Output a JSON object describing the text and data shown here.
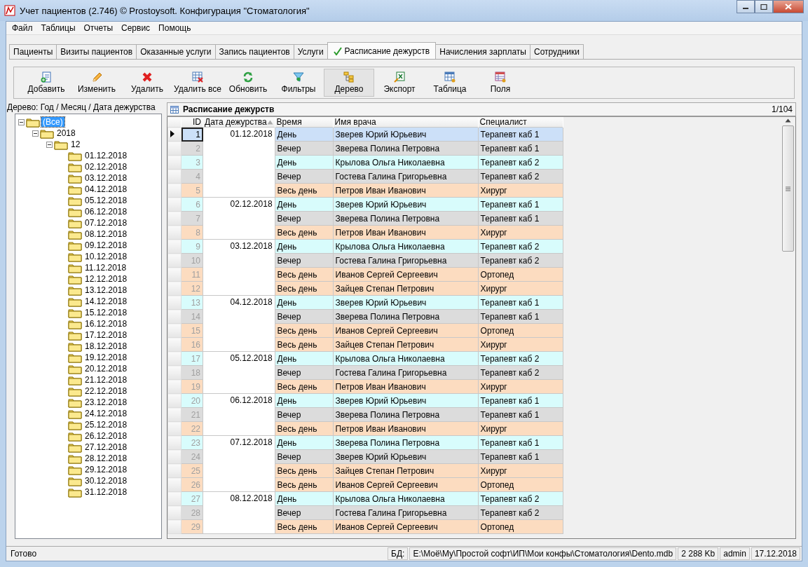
{
  "window": {
    "title": "Учет пациентов (2.746) © Prostoysoft. Конфигурация \"Стоматология\""
  },
  "menu": [
    "Файл",
    "Таблицы",
    "Отчеты",
    "Сервис",
    "Помощь"
  ],
  "tabs": [
    {
      "label": "Пациенты",
      "selected": false
    },
    {
      "label": "Визиты пациентов",
      "selected": false
    },
    {
      "label": "Оказанные услуги",
      "selected": false
    },
    {
      "label": "Запись пациентов",
      "selected": false
    },
    {
      "label": "Услуги",
      "selected": false
    },
    {
      "label": "Расписание дежурств",
      "selected": true
    },
    {
      "label": "Начисления зарплаты",
      "selected": false
    },
    {
      "label": "Сотрудники",
      "selected": false
    }
  ],
  "toolbar": [
    {
      "label": "Добавить",
      "kind": "add",
      "pressed": false
    },
    {
      "label": "Изменить",
      "kind": "edit",
      "pressed": false
    },
    {
      "label": "Удалить",
      "kind": "delete",
      "pressed": false
    },
    {
      "label": "Удалить все",
      "kind": "deleteall",
      "pressed": false
    },
    {
      "label": "Обновить",
      "kind": "refresh",
      "pressed": false
    },
    {
      "label": "Фильтры",
      "kind": "filter",
      "pressed": false
    },
    {
      "label": "Дерево",
      "kind": "tree",
      "pressed": true
    },
    {
      "label": "Экспорт",
      "kind": "export",
      "pressed": false
    },
    {
      "label": "Таблица",
      "kind": "table",
      "pressed": false
    },
    {
      "label": "Поля",
      "kind": "fields",
      "pressed": false
    }
  ],
  "tree": {
    "caption": "Дерево: Год / Месяц / Дата дежурства",
    "nodes": [
      {
        "label": "(Все)",
        "selected": true,
        "expanded": true,
        "children": [
          {
            "label": "2018",
            "selected": false,
            "expanded": true,
            "children": [
              {
                "label": "12",
                "selected": false,
                "expanded": true,
                "children": [
                  {
                    "label": "01.12.2018",
                    "selected": false
                  },
                  {
                    "label": "02.12.2018",
                    "selected": false
                  },
                  {
                    "label": "03.12.2018",
                    "selected": false
                  },
                  {
                    "label": "04.12.2018",
                    "selected": false
                  },
                  {
                    "label": "05.12.2018",
                    "selected": false
                  },
                  {
                    "label": "06.12.2018",
                    "selected": false
                  },
                  {
                    "label": "07.12.2018",
                    "selected": false
                  },
                  {
                    "label": "08.12.2018",
                    "selected": false
                  },
                  {
                    "label": "09.12.2018",
                    "selected": false
                  },
                  {
                    "label": "10.12.2018",
                    "selected": false
                  },
                  {
                    "label": "11.12.2018",
                    "selected": false
                  },
                  {
                    "label": "12.12.2018",
                    "selected": false
                  },
                  {
                    "label": "13.12.2018",
                    "selected": false
                  },
                  {
                    "label": "14.12.2018",
                    "selected": false
                  },
                  {
                    "label": "15.12.2018",
                    "selected": false
                  },
                  {
                    "label": "16.12.2018",
                    "selected": false
                  },
                  {
                    "label": "17.12.2018",
                    "selected": false
                  },
                  {
                    "label": "18.12.2018",
                    "selected": false
                  },
                  {
                    "label": "19.12.2018",
                    "selected": false
                  },
                  {
                    "label": "20.12.2018",
                    "selected": false
                  },
                  {
                    "label": "21.12.2018",
                    "selected": false
                  },
                  {
                    "label": "22.12.2018",
                    "selected": false
                  },
                  {
                    "label": "23.12.2018",
                    "selected": false
                  },
                  {
                    "label": "24.12.2018",
                    "selected": false
                  },
                  {
                    "label": "25.12.2018",
                    "selected": false
                  },
                  {
                    "label": "26.12.2018",
                    "selected": false
                  },
                  {
                    "label": "27.12.2018",
                    "selected": false
                  },
                  {
                    "label": "28.12.2018",
                    "selected": false
                  },
                  {
                    "label": "29.12.2018",
                    "selected": false
                  },
                  {
                    "label": "30.12.2018",
                    "selected": false
                  },
                  {
                    "label": "31.12.2018",
                    "selected": false
                  }
                ]
              }
            ]
          }
        ]
      }
    ]
  },
  "table": {
    "title": "Расписание дежурств",
    "counter": "1/104",
    "columns": [
      {
        "label": "ID",
        "sorted": false
      },
      {
        "label": "Дата дежурства",
        "sorted": true
      },
      {
        "label": "Время",
        "sorted": false
      },
      {
        "label": "Имя врача",
        "sorted": false
      },
      {
        "label": "Специалист",
        "sorted": false
      }
    ],
    "groups": [
      {
        "date": "01.12.2018",
        "rows": [
          {
            "id": "1",
            "time": "День",
            "doctor": "Зверев Юрий Юрьевич",
            "specialist": "Терапевт каб 1",
            "color": "#cce0f8",
            "selected": true
          },
          {
            "id": "2",
            "time": "Вечер",
            "doctor": "Зверева Полина Петровна",
            "specialist": "Терапевт каб 1",
            "color": "#dcdcdc",
            "selected": false
          },
          {
            "id": "3",
            "time": "День",
            "doctor": "Крылова Ольга Николаевна",
            "specialist": "Терапевт каб 2",
            "color": "#d8fcfc",
            "selected": false
          },
          {
            "id": "4",
            "time": "Вечер",
            "doctor": "Гостева Галина Григорьевна",
            "specialist": "Терапевт каб 2",
            "color": "#dcdcdc",
            "selected": false
          },
          {
            "id": "5",
            "time": "Весь день",
            "doctor": "Петров Иван Иванович",
            "specialist": "Хирург",
            "color": "#fcdcc0",
            "selected": false
          }
        ]
      },
      {
        "date": "02.12.2018",
        "rows": [
          {
            "id": "6",
            "time": "День",
            "doctor": "Зверев Юрий Юрьевич",
            "specialist": "Терапевт каб 1",
            "color": "#d8fcfc",
            "selected": false
          },
          {
            "id": "7",
            "time": "Вечер",
            "doctor": "Зверева Полина Петровна",
            "specialist": "Терапевт каб 1",
            "color": "#dcdcdc",
            "selected": false
          },
          {
            "id": "8",
            "time": "Весь день",
            "doctor": "Петров Иван Иванович",
            "specialist": "Хирург",
            "color": "#fcdcc0",
            "selected": false
          }
        ]
      },
      {
        "date": "03.12.2018",
        "rows": [
          {
            "id": "9",
            "time": "День",
            "doctor": "Крылова Ольга Николаевна",
            "specialist": "Терапевт каб 2",
            "color": "#d8fcfc",
            "selected": false
          },
          {
            "id": "10",
            "time": "Вечер",
            "doctor": "Гостева Галина Григорьевна",
            "specialist": "Терапевт каб 2",
            "color": "#dcdcdc",
            "selected": false
          },
          {
            "id": "11",
            "time": "Весь день",
            "doctor": "Иванов Сергей Сергеевич",
            "specialist": "Ортопед",
            "color": "#fcdcc0",
            "selected": false
          },
          {
            "id": "12",
            "time": "Весь день",
            "doctor": "Зайцев Степан Петрович",
            "specialist": "Хирург",
            "color": "#fcdcc0",
            "selected": false
          }
        ]
      },
      {
        "date": "04.12.2018",
        "rows": [
          {
            "id": "13",
            "time": "День",
            "doctor": "Зверев Юрий Юрьевич",
            "specialist": "Терапевт каб 1",
            "color": "#d8fcfc",
            "selected": false
          },
          {
            "id": "14",
            "time": "Вечер",
            "doctor": "Зверева Полина Петровна",
            "specialist": "Терапевт каб 1",
            "color": "#dcdcdc",
            "selected": false
          },
          {
            "id": "15",
            "time": "Весь день",
            "doctor": "Иванов Сергей Сергеевич",
            "specialist": "Ортопед",
            "color": "#fcdcc0",
            "selected": false
          },
          {
            "id": "16",
            "time": "Весь день",
            "doctor": "Зайцев Степан Петрович",
            "specialist": "Хирург",
            "color": "#fcdcc0",
            "selected": false
          }
        ]
      },
      {
        "date": "05.12.2018",
        "rows": [
          {
            "id": "17",
            "time": "День",
            "doctor": "Крылова Ольга Николаевна",
            "specialist": "Терапевт каб 2",
            "color": "#d8fcfc",
            "selected": false
          },
          {
            "id": "18",
            "time": "Вечер",
            "doctor": "Гостева Галина Григорьевна",
            "specialist": "Терапевт каб 2",
            "color": "#dcdcdc",
            "selected": false
          },
          {
            "id": "19",
            "time": "Весь день",
            "doctor": "Петров Иван Иванович",
            "specialist": "Хирург",
            "color": "#fcdcc0",
            "selected": false
          }
        ]
      },
      {
        "date": "06.12.2018",
        "rows": [
          {
            "id": "20",
            "time": "День",
            "doctor": "Зверев Юрий Юрьевич",
            "specialist": "Терапевт каб 1",
            "color": "#d8fcfc",
            "selected": false
          },
          {
            "id": "21",
            "time": "Вечер",
            "doctor": "Зверева Полина Петровна",
            "specialist": "Терапевт каб 1",
            "color": "#dcdcdc",
            "selected": false
          },
          {
            "id": "22",
            "time": "Весь день",
            "doctor": "Петров Иван Иванович",
            "specialist": "Хирург",
            "color": "#fcdcc0",
            "selected": false
          }
        ]
      },
      {
        "date": "07.12.2018",
        "rows": [
          {
            "id": "23",
            "time": "День",
            "doctor": "Зверева Полина Петровна",
            "specialist": "Терапевт каб 1",
            "color": "#d8fcfc",
            "selected": false
          },
          {
            "id": "24",
            "time": "Вечер",
            "doctor": "Зверев Юрий Юрьевич",
            "specialist": "Терапевт каб 1",
            "color": "#dcdcdc",
            "selected": false
          },
          {
            "id": "25",
            "time": "Весь день",
            "doctor": "Зайцев Степан Петрович",
            "specialist": "Хирург",
            "color": "#fcdcc0",
            "selected": false
          },
          {
            "id": "26",
            "time": "Весь день",
            "doctor": "Иванов Сергей Сергеевич",
            "specialist": "Ортопед",
            "color": "#fcdcc0",
            "selected": false
          }
        ]
      },
      {
        "date": "08.12.2018",
        "rows": [
          {
            "id": "27",
            "time": "День",
            "doctor": "Крылова Ольга Николаевна",
            "specialist": "Терапевт каб 2",
            "color": "#d8fcfc",
            "selected": false
          },
          {
            "id": "28",
            "time": "Вечер",
            "doctor": "Гостева Галина Григорьевна",
            "specialist": "Терапевт каб 2",
            "color": "#dcdcdc",
            "selected": false
          },
          {
            "id": "29",
            "time": "Весь день",
            "doctor": "Иванов Сергей Сергеевич",
            "specialist": "Ортопед",
            "color": "#fcdcc0",
            "selected": false
          }
        ]
      }
    ]
  },
  "status_bar": {
    "status": "Готово",
    "db_label": "БД:",
    "db_path": "E:\\Моё\\Му\\Простой софт\\ИП\\Мои конфы\\Стоматология\\Dento.mdb",
    "size": "2 288 Kb",
    "user": "admin",
    "date": "17.12.2018"
  }
}
